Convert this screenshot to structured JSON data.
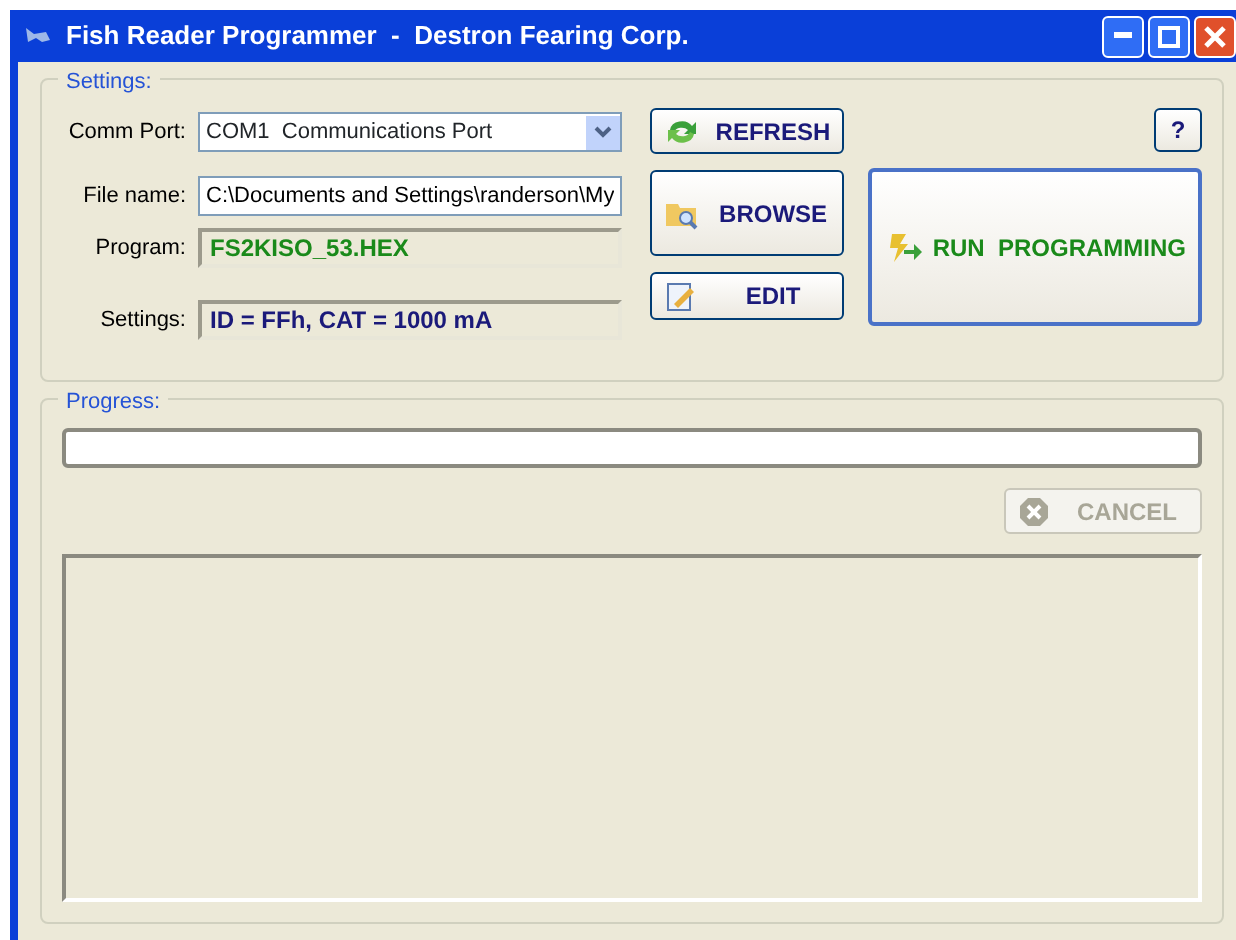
{
  "window": {
    "title": "Fish Reader Programmer  -  Destron Fearing Corp."
  },
  "settings": {
    "legend": "Settings:",
    "comm_port": {
      "label": "Comm Port:",
      "value": "COM1  Communications Port"
    },
    "file_name": {
      "label": "File name:",
      "value": "C:\\Documents and Settings\\randerson\\My"
    },
    "program": {
      "label": "Program:",
      "value": "FS2KISO_53.HEX"
    },
    "settings_value": {
      "label": "Settings:",
      "value": "ID = FFh, CAT = 1000 mA"
    },
    "refresh": {
      "label": "REFRESH"
    },
    "help": {
      "label": "?"
    },
    "browse": {
      "label": "BROWSE"
    },
    "edit": {
      "label": "EDIT"
    },
    "run": {
      "label": "RUN  PROGRAMMING"
    }
  },
  "progress": {
    "legend": "Progress:",
    "level": 0,
    "cancel": {
      "label": "CANCEL",
      "disabled": true
    }
  }
}
